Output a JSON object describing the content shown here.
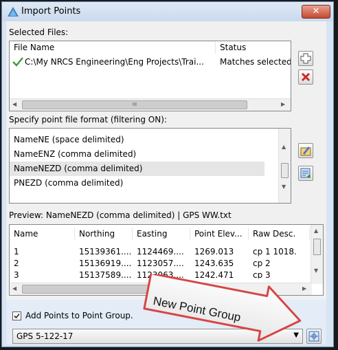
{
  "window": {
    "title": "Import Points",
    "close_glyph": "✕"
  },
  "files": {
    "label": "Selected Files:",
    "columns": [
      "File Name",
      "Status"
    ],
    "rows": [
      {
        "file": "C:\\My NRCS Engineering\\Eng Projects\\Trai...",
        "status": "Matches selected f"
      }
    ],
    "hscroll_thumb_glyph": "III"
  },
  "format": {
    "label": "Specify point file format (filtering ON):",
    "options": [
      "NameNE (space delimited)",
      "NameENZ (comma delimited)",
      "NameNEZD (comma delimited)",
      "PNEZD (comma delimited)"
    ],
    "selected_index": 2
  },
  "preview": {
    "label": "Preview: NameNEZD (comma delimited) | GPS WW.txt",
    "columns": [
      "Name",
      "Northing",
      "Easting",
      "Point Elev...",
      "Raw Desc."
    ],
    "rows": [
      [
        "1",
        "15139361....",
        "1124469....",
        "1269.013",
        "cp 1 1018."
      ],
      [
        "2",
        "15136919....",
        "1123057....",
        "1243.635",
        "cp 2"
      ],
      [
        "3",
        "15137589....",
        "1123063....",
        "1242.471",
        "cp 3"
      ]
    ]
  },
  "point_group": {
    "checkbox_label": "Add Points to Point Group.",
    "checked": true,
    "selected_value": "GPS 5-122-17"
  },
  "callout": {
    "text": "New Point Group"
  },
  "colors": {
    "accent_red": "#d64545",
    "close_red": "#c44a30",
    "title_bg": "#d7e4f2"
  },
  "icons": [
    "app-triangle-icon",
    "add-file-icon",
    "remove-file-icon",
    "edit-format-icon",
    "manage-format-icon",
    "new-point-group-icon",
    "checkmark-icon"
  ]
}
